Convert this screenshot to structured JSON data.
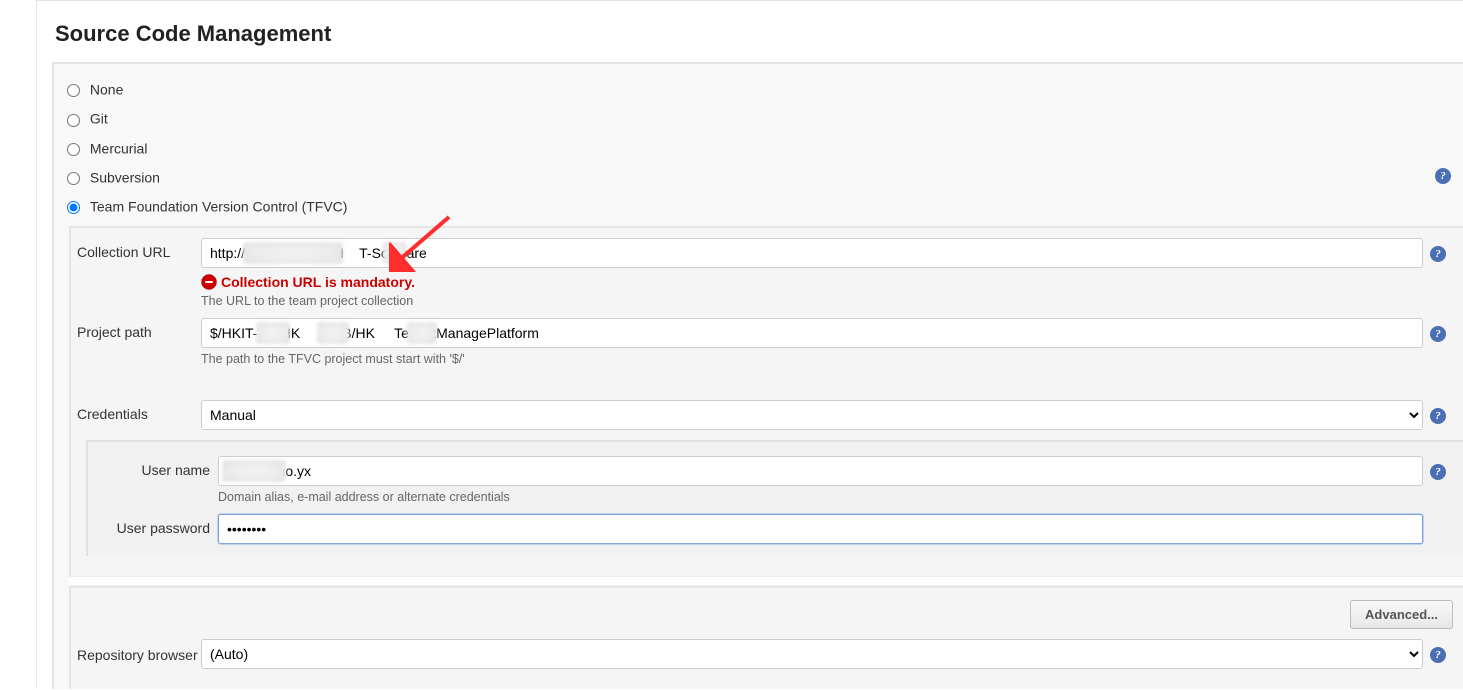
{
  "section_title": "Source Code Management",
  "scm": {
    "options": [
      {
        "id": "none",
        "label": "None"
      },
      {
        "id": "git",
        "label": "Git"
      },
      {
        "id": "mercurial",
        "label": "Mercurial"
      },
      {
        "id": "subversion",
        "label": "Subversion"
      },
      {
        "id": "tfvc",
        "label": "Team Foundation Version Control (TFVC)"
      }
    ],
    "selected": "tfvc"
  },
  "tfvc": {
    "collection_url": {
      "label": "Collection URL",
      "value": "http://             30/tfs/H    T-Software",
      "error": "Collection URL is mandatory.",
      "hint": "The URL to the team project collection"
    },
    "project_path": {
      "label": "Project path",
      "value": "$/HKIT-     /HK     WEB/HK     TenantManagePlatform",
      "hint": "The path to the TFVC project must start with '$/'"
    },
    "credentials": {
      "label": "Credentials",
      "selected": "Manual",
      "username": {
        "label": "User name",
        "value": "          t\\mo.yx",
        "hint": "Domain alias, e-mail address or alternate credentials"
      },
      "password": {
        "label": "User password",
        "value": "••••••••"
      }
    },
    "advanced_button": "Advanced...",
    "repo_browser": {
      "label": "Repository browser",
      "selected": "(Auto)"
    }
  }
}
